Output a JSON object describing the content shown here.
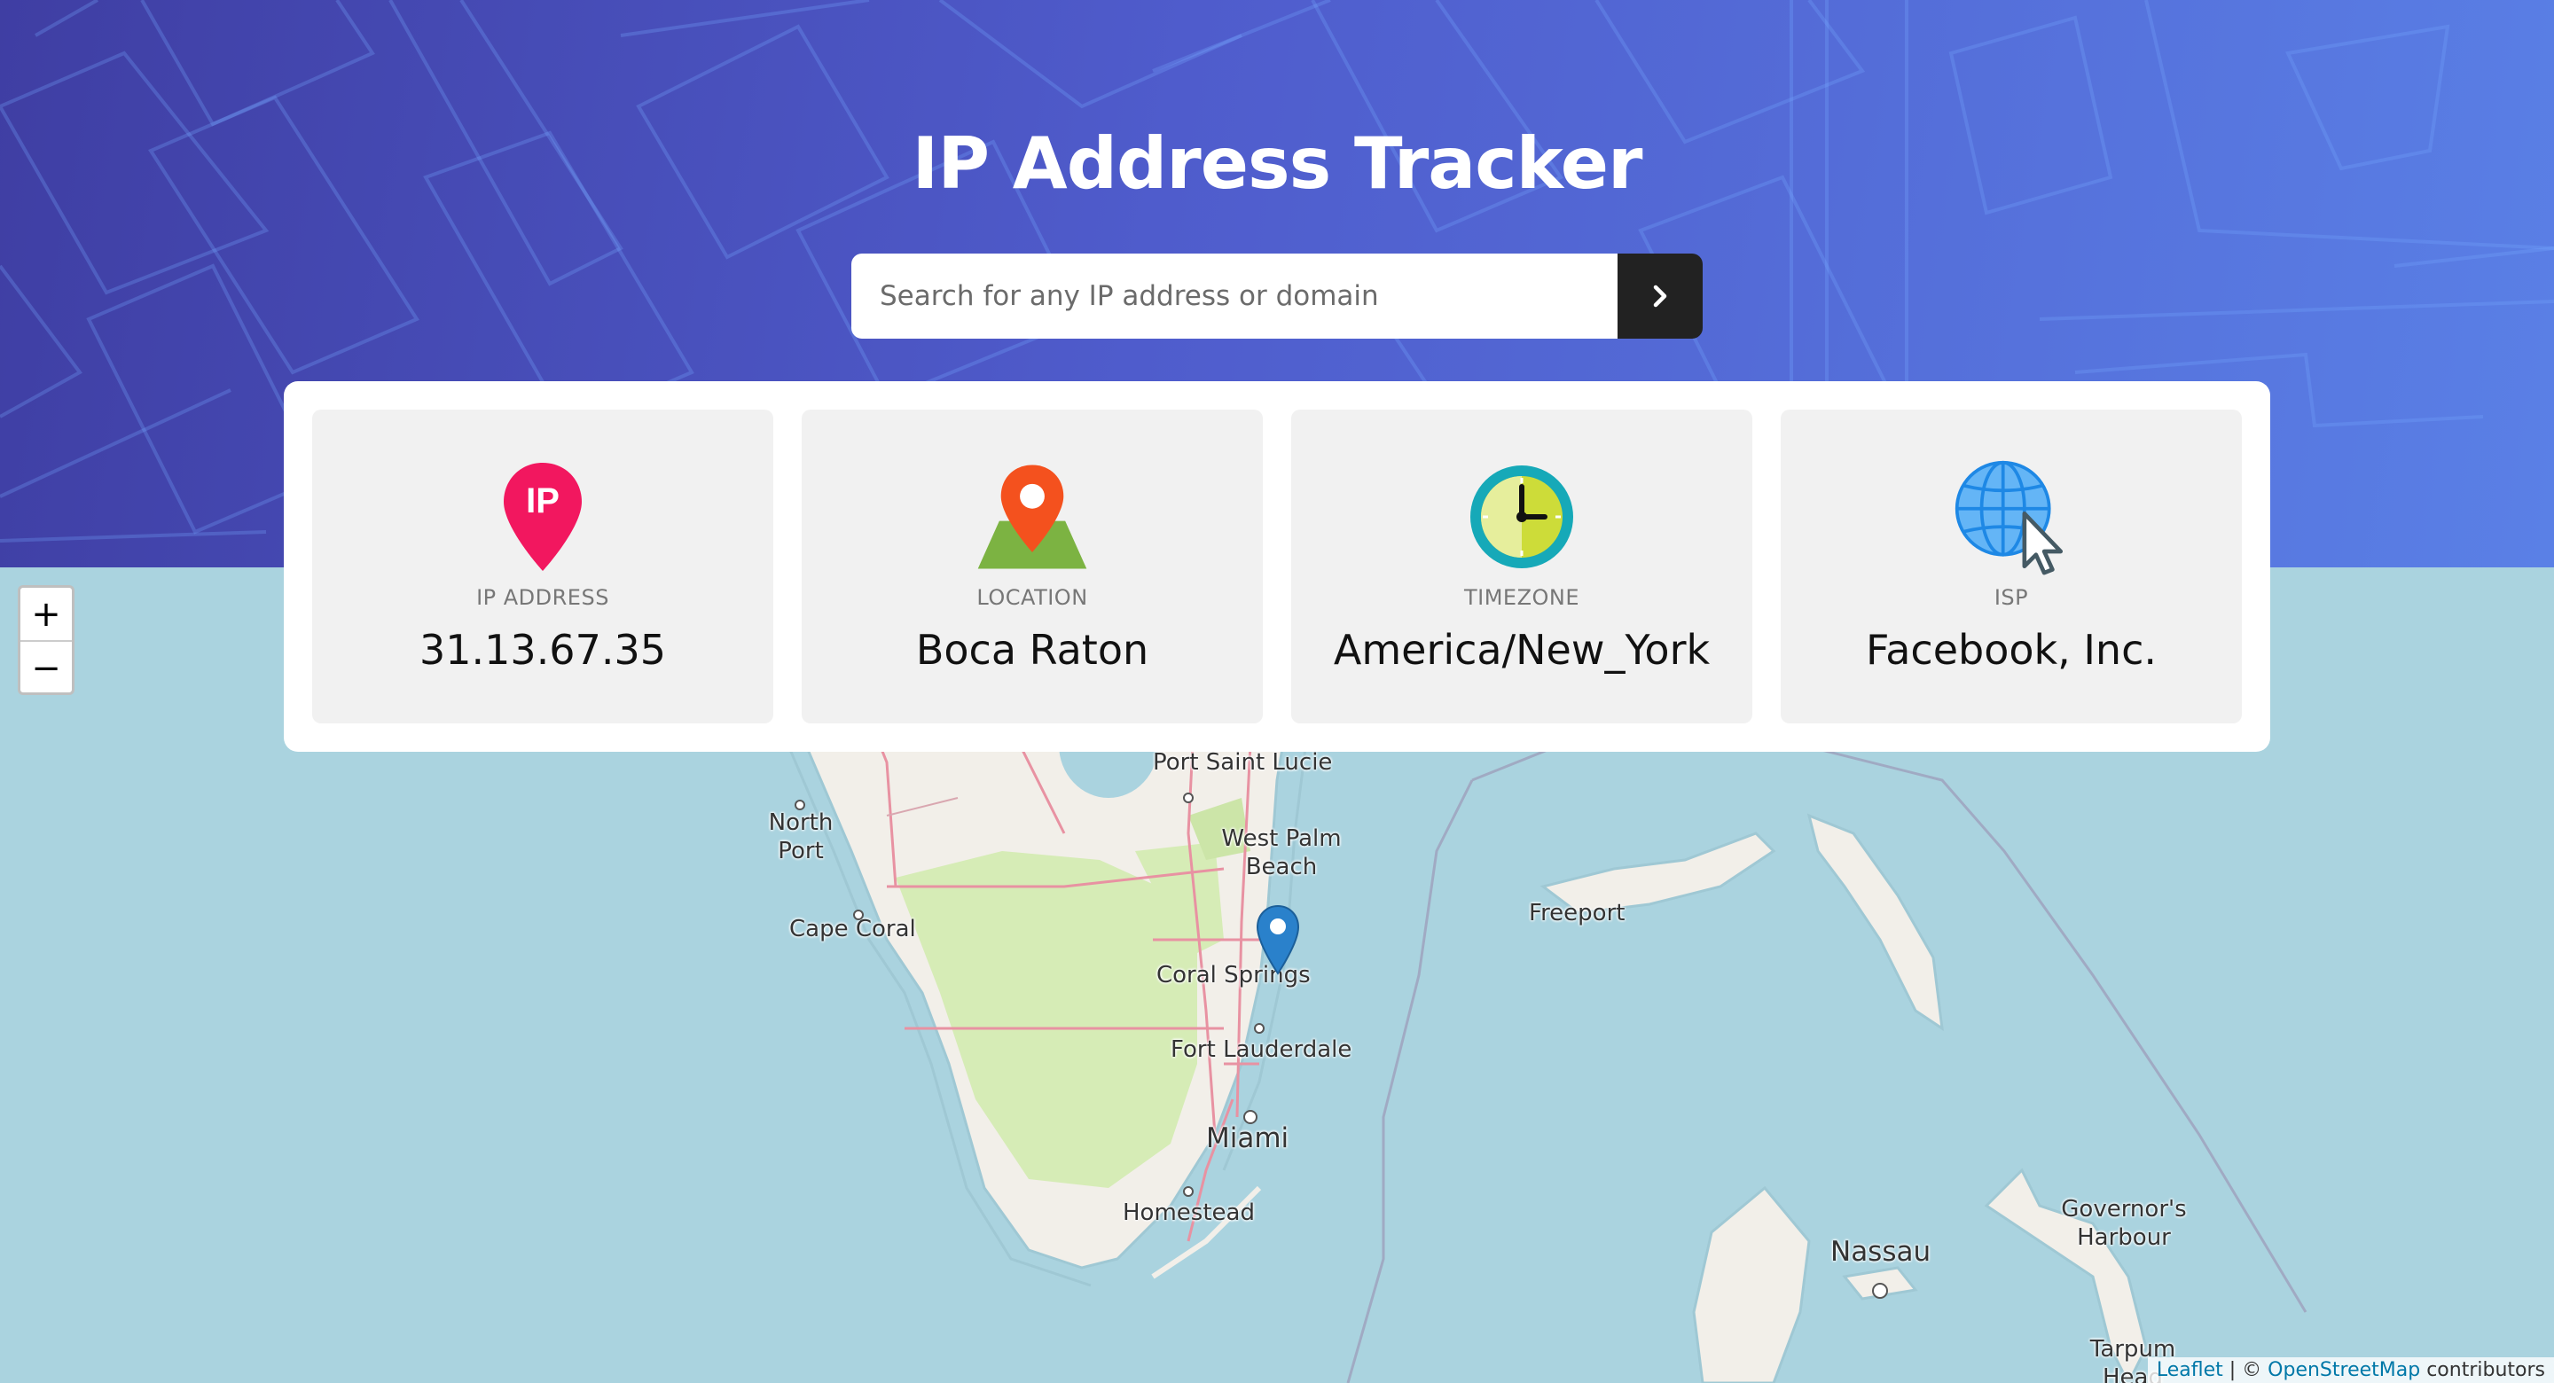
{
  "header": {
    "title": "IP Address Tracker",
    "search": {
      "placeholder": "Search for any IP address or domain",
      "value": ""
    },
    "submit_icon": "chevron-right-icon",
    "background_colors": [
      "#3f3ea3",
      "#5a80e6"
    ]
  },
  "info": [
    {
      "icon": "ip-pin-icon",
      "label": "IP ADDRESS",
      "value": "31.13.67.35"
    },
    {
      "icon": "location-pin-icon",
      "label": "LOCATION",
      "value": "Boca Raton"
    },
    {
      "icon": "clock-icon",
      "label": "TIMEZONE",
      "value": "America/New_York"
    },
    {
      "icon": "globe-cursor-icon",
      "label": "ISP",
      "value": "Facebook, Inc."
    }
  ],
  "map": {
    "zoom_in": "+",
    "zoom_out": "−",
    "places": {
      "port_saint_lucie": "Port Saint Lucie",
      "north_port": "North Port",
      "west_palm_beach": "West Palm Beach",
      "cape_coral": "Cape Coral",
      "coral_springs": "Coral Springs",
      "freeport": "Freeport",
      "fort_lauderdale": "Fort Lauderdale",
      "miami": "Miami",
      "homestead": "Homestead",
      "nassau": "Nassau",
      "governors_harbour": "Governor's Harbour",
      "tarpum_head": "Tarpum Head"
    },
    "attribution": {
      "leaflet": "Leaflet",
      "separator": " | © ",
      "osm": "OpenStreetMap",
      "suffix": " contributors"
    },
    "colors": {
      "water": "#aad3df",
      "land": "#f2efe9",
      "park": "#d8ecb8",
      "road": "#e892a2",
      "marker": "#2a81cb"
    }
  }
}
